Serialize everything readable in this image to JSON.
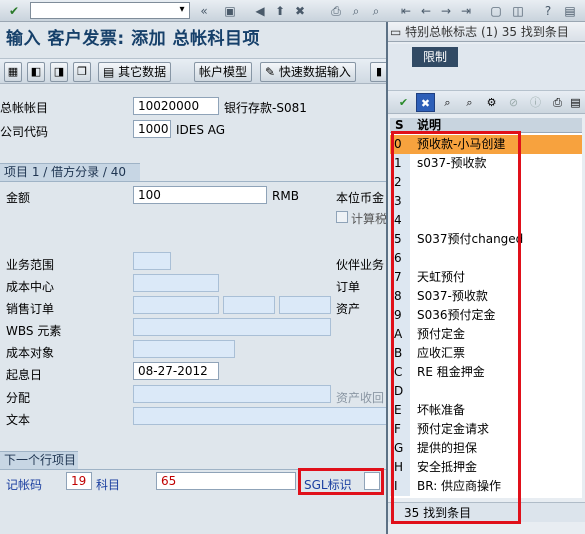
{
  "toolbar": {
    "command_field": "",
    "icons": [
      "enter-icon",
      "save-icon",
      "back-icon",
      "exit-icon",
      "cancel-icon",
      "print-icon",
      "find-icon",
      "find-next-icon",
      "first-page-icon",
      "prev-page-icon",
      "next-page-icon",
      "last-page-icon",
      "new-session-icon",
      "shortcut-icon",
      "help-icon"
    ]
  },
  "title": "输入 客户发票: 添加 总帐科目项",
  "app_toolbar": {
    "other_data": "其它数据",
    "account_model": "帐户模型",
    "fast_entry": "快速数据输入"
  },
  "header": {
    "gl_account_label": "总帐帐目",
    "gl_account_value": "10020000",
    "gl_account_desc": "银行存款-S081",
    "company_code_label": "公司代码",
    "company_code_value": "1000",
    "company_code_desc": "IDES AG"
  },
  "item_section": {
    "header": "项目 1 / 借方分录 / 40",
    "amount_label": "金额",
    "amount_value": "100",
    "currency": "RMB",
    "local_currency_label": "本位币金",
    "calc_tax_label": "计算税",
    "business_area_label": "业务范围",
    "partner_area_label": "伙伴业务",
    "cost_center_label": "成本中心",
    "order_label": "订单",
    "sales_order_label": "销售订单",
    "asset_label": "资产",
    "wbs_label": "WBS 元素",
    "cost_object_label": "成本对象",
    "value_date_label": "起息日",
    "value_date_value": "08-27-2012",
    "asset_retirement_label": "资产收回",
    "assignment_label": "分配",
    "text_label": "文本"
  },
  "next_item": {
    "header": "下一个行项目",
    "posting_key_label": "记帐码",
    "posting_key_value": "19",
    "account_label": "科目",
    "account_value": "65",
    "sgl_label": "SGL标识"
  },
  "popup": {
    "title": "特别总帐标志 (1)   35 找到条目",
    "tab": "限制",
    "col_s": "S",
    "col_desc": "说明",
    "rows": [
      {
        "s": "0",
        "desc": "预收款-小马创建"
      },
      {
        "s": "1",
        "desc": "s037-预收款"
      },
      {
        "s": "2",
        "desc": ""
      },
      {
        "s": "3",
        "desc": ""
      },
      {
        "s": "4",
        "desc": ""
      },
      {
        "s": "5",
        "desc": "S037预付changed"
      },
      {
        "s": "6",
        "desc": ""
      },
      {
        "s": "7",
        "desc": "天虹预付"
      },
      {
        "s": "8",
        "desc": "S037-预收款"
      },
      {
        "s": "9",
        "desc": "S036预付定金"
      },
      {
        "s": "A",
        "desc": "预付定金"
      },
      {
        "s": "B",
        "desc": "应收汇票"
      },
      {
        "s": "C",
        "desc": "RE 租金押金"
      },
      {
        "s": "D",
        "desc": ""
      },
      {
        "s": "E",
        "desc": "坏帐准备"
      },
      {
        "s": "F",
        "desc": "预付定金请求"
      },
      {
        "s": "G",
        "desc": "提供的担保"
      },
      {
        "s": "H",
        "desc": "安全抵押金"
      },
      {
        "s": "I",
        "desc": "BR: 供应商操作"
      }
    ],
    "status": "35 找到条目"
  },
  "colors": {
    "title": "#16406a",
    "selected_row": "#f7a23e",
    "highlight_box": "#e0101a",
    "tab_bg": "#314a64"
  }
}
